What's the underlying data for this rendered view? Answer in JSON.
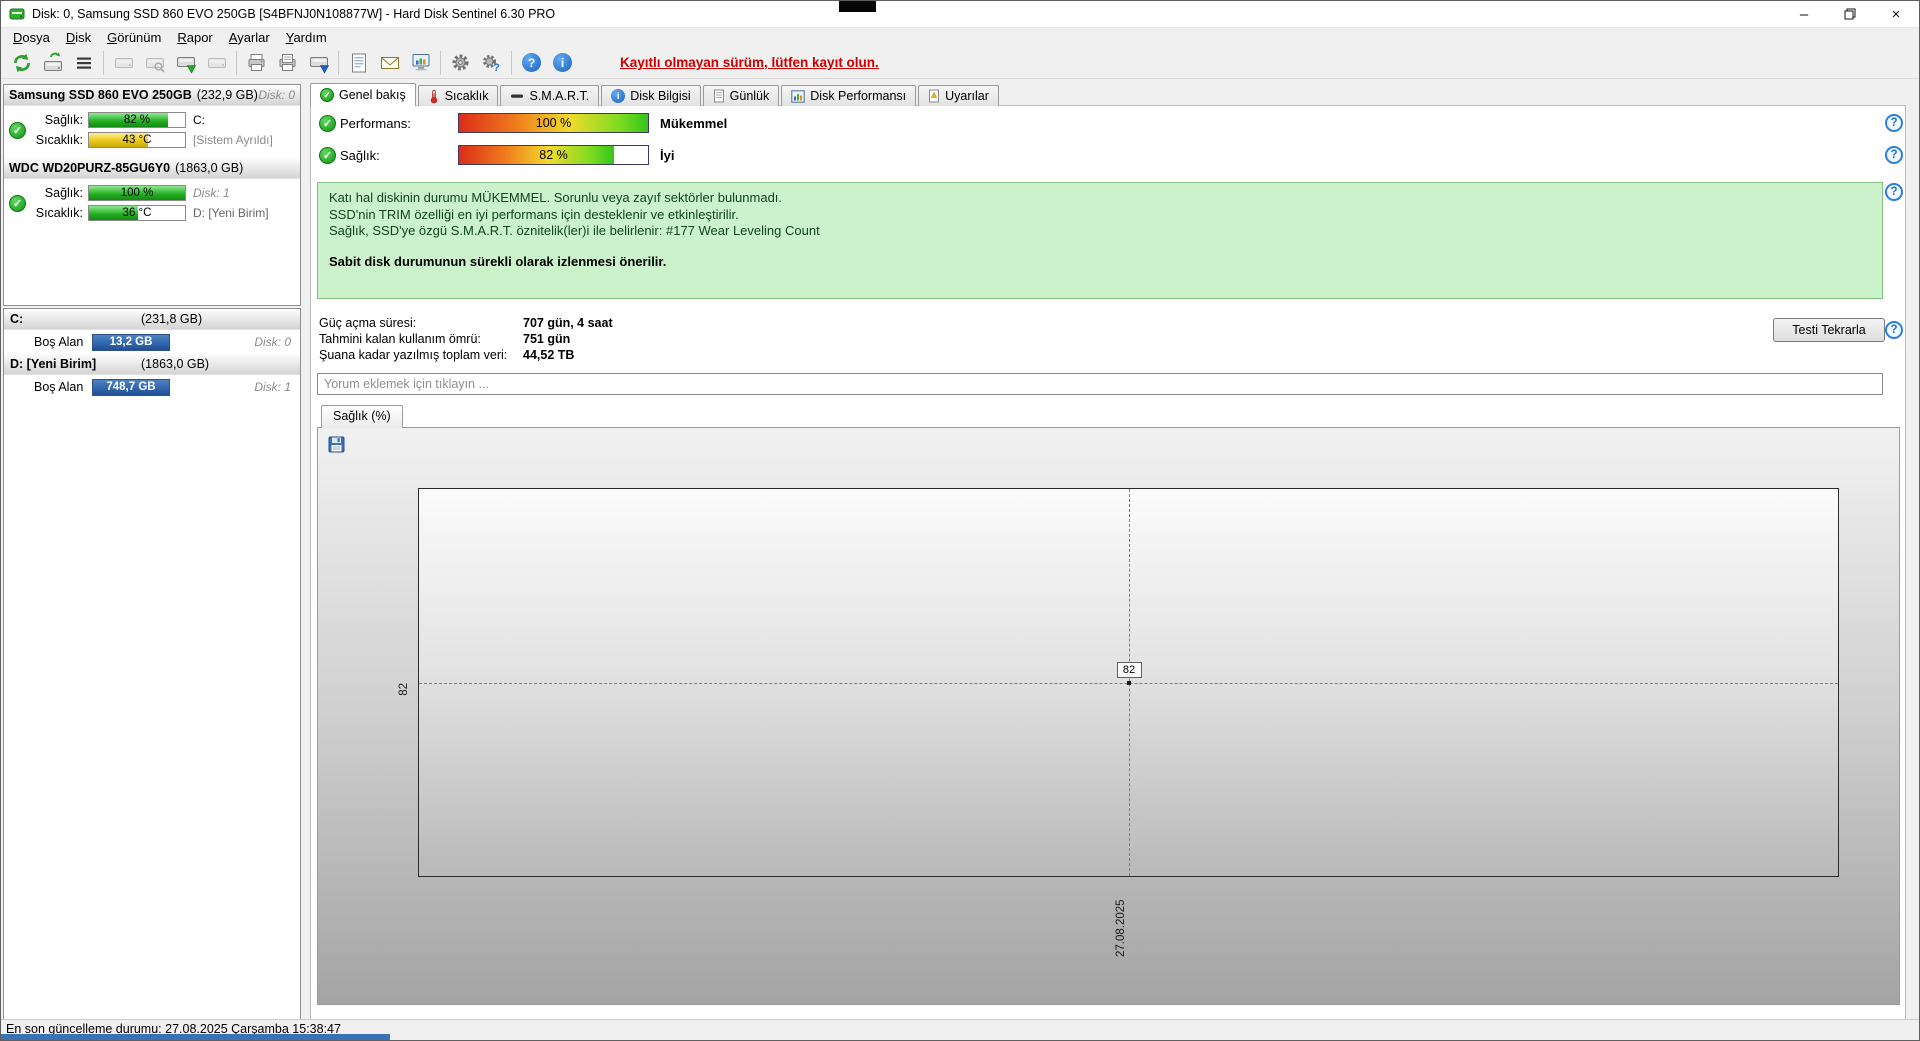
{
  "window": {
    "title": "Disk: 0, Samsung SSD 860 EVO 250GB [S4BFNJ0N108877W]  -  Hard Disk Sentinel 6.30 PRO"
  },
  "icons": {
    "check": "✓",
    "help": "?",
    "info": "i",
    "minimize": "–",
    "close": "×"
  },
  "colors": {
    "health_green": "#21ad21",
    "temp_yellow": "#e7c414",
    "partition_blue": "#1d4f97",
    "register_red": "#cc0000",
    "info_green_bg": "#cbf2cb"
  },
  "menubar": {
    "items": [
      "Dosya",
      "Disk",
      "Görünüm",
      "Rapor",
      "Ayarlar",
      "Yardım"
    ]
  },
  "toolbar": {
    "register_link": "Kayıtlı olmayan sürüm, lütfen kayıt olun.",
    "icons": [
      "refresh",
      "detect-disks",
      "menu-list",
      "drive",
      "drive-test",
      "drive-arrow-green",
      "drive-offline",
      "printer",
      "print-report",
      "drive-arrow-blue",
      "report",
      "email",
      "monitor",
      "settings-gear",
      "gear-help",
      "help",
      "info"
    ]
  },
  "sidebar": {
    "disks": [
      {
        "name": "Samsung SSD 860 EVO 250GB",
        "size": "(232,9 GB)",
        "id": "Disk: 0",
        "health_label": "Sağlık:",
        "health_value": "82 %",
        "health_pct": 82,
        "health_right": "C:",
        "temp_label": "Sıcaklık:",
        "temp_value": "43 °C",
        "temp_pct": 61,
        "temp_right": "[Sistem Ayrıldı]"
      },
      {
        "name": "WDC WD20PURZ-85GU6Y0",
        "size": "(1863,0 GB)",
        "id": "",
        "health_label": "Sağlık:",
        "health_value": "100 %",
        "health_pct": 100,
        "health_right": "Disk: 1",
        "temp_label": "Sıcaklık:",
        "temp_value": "36 °C",
        "temp_pct": 51,
        "temp_right": "D: [Yeni Birim]"
      }
    ],
    "partitions": [
      {
        "name": "C:",
        "size": "(231,8 GB)",
        "free_label": "Boş Alan",
        "free_value": "13,2 GB",
        "disk": "Disk: 0"
      },
      {
        "name": "D: [Yeni Birim]",
        "size": "(1863,0 GB)",
        "free_label": "Boş Alan",
        "free_value": "748,7 GB",
        "disk": "Disk: 1"
      }
    ]
  },
  "tabs": {
    "items": [
      {
        "label": "Genel bakış"
      },
      {
        "label": "Sıcaklık"
      },
      {
        "label": "S.M.A.R.T."
      },
      {
        "label": "Disk Bilgisi"
      },
      {
        "label": "Günlük"
      },
      {
        "label": "Disk Performansı"
      },
      {
        "label": "Uyarılar"
      }
    ]
  },
  "overview": {
    "performance": {
      "label": "Performans:",
      "value": "100 %",
      "pct": 100,
      "rating": "Mükemmel"
    },
    "health": {
      "label": "Sağlık:",
      "value": "82 %",
      "pct": 82,
      "rating": "İyi"
    },
    "info_box": {
      "line1": "Katı hal diskinin durumu MÜKEMMEL. Sorunlu veya zayıf sektörler bulunmadı.",
      "line2": "SSD'nin TRIM özelliği en iyi performans için desteklenir ve etkinleştirilir.",
      "line3": "Sağlık, SSD'ye özgü S.M.A.R.T. öznitelik(ler)i ile belirlenir:  #177 Wear Leveling Count",
      "emphasis": "Sabit disk durumunun sürekli olarak izlenmesi önerilir."
    },
    "stats": [
      {
        "label": "Güç açma süresi:",
        "value": "707 gün, 4 saat"
      },
      {
        "label": "Tahmini kalan kullanım ömrü:",
        "value": "751 gün"
      },
      {
        "label": "Şuana kadar yazılmış toplam veri:",
        "value": "44,52 TB"
      }
    ],
    "retest_button": "Testi Tekrarla",
    "comment_placeholder": "Yorum eklemek için tıklayın ..."
  },
  "chart": {
    "tab": "Sağlık (%)",
    "value_label": "82",
    "axis_value": "82",
    "axis_date": "27.08.2025"
  },
  "chart_data": {
    "type": "line",
    "title": "Sağlık (%)",
    "x": [
      "27.08.2025"
    ],
    "series": [
      {
        "name": "Sağlık (%)",
        "values": [
          82
        ]
      }
    ],
    "ylim": [
      0,
      100
    ],
    "annotations": [
      "82"
    ],
    "legend": "none",
    "grid": "dashed-crosshair"
  },
  "statusbar": {
    "text": "En son güncelleme durumu: 27.08.2025 Çarşamba 15:38:47"
  }
}
